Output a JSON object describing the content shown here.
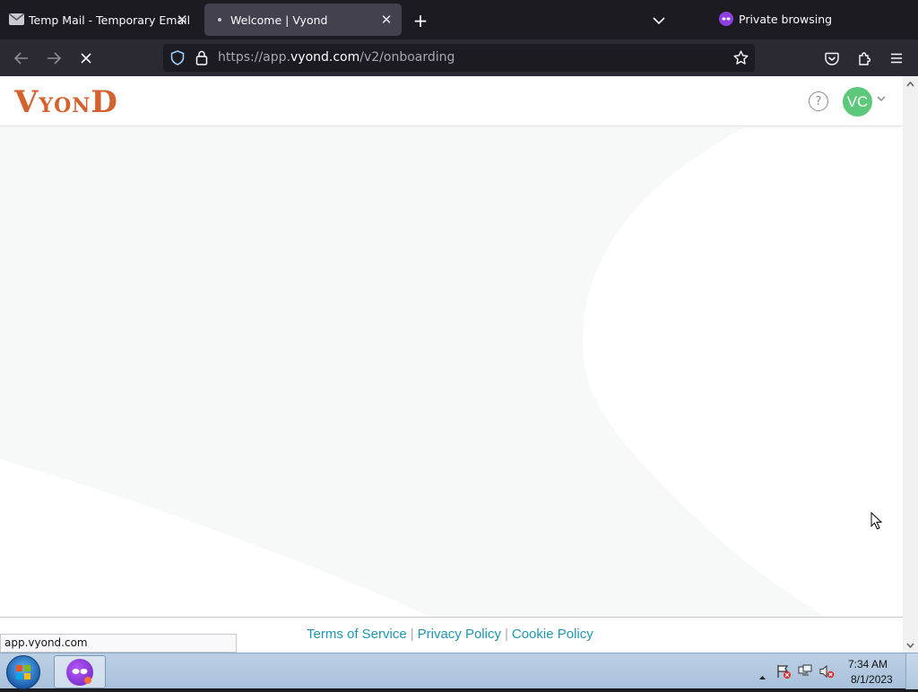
{
  "browser": {
    "tabs": [
      {
        "label": "Temp Mail - Temporary Email",
        "active": false
      },
      {
        "label": "Welcome | Vyond",
        "active": true
      }
    ],
    "private_label": "Private browsing",
    "url": {
      "prefix": "https://app.",
      "domain": "vyond.com",
      "path": "/v2/onboarding"
    },
    "status_url": "app.vyond.com"
  },
  "page": {
    "logo_text": "VYOND",
    "avatar_initials": "VC",
    "help_glyph": "?",
    "footer": {
      "terms": "Terms of Service",
      "privacy": "Privacy Policy",
      "cookie": "Cookie Policy",
      "separator": "|"
    }
  },
  "taskbar": {
    "time": "7:34 AM",
    "date": "8/1/2023"
  },
  "colors": {
    "brand_orange": "#d4622e",
    "link_teal": "#1d97b0",
    "avatar_green": "#5cc97a",
    "private_purple": "#8f3fe0"
  }
}
